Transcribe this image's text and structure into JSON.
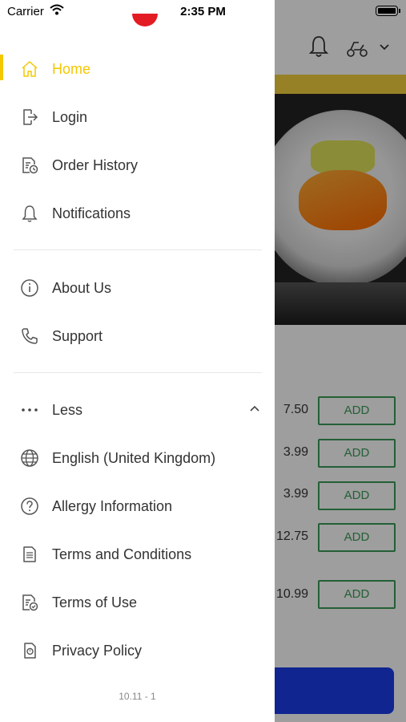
{
  "status_bar": {
    "carrier": "Carrier",
    "time": "2:35 PM"
  },
  "menu": {
    "primary": [
      {
        "label": "Home",
        "icon": "home-icon",
        "active": true
      },
      {
        "label": "Login",
        "icon": "login-icon"
      },
      {
        "label": "Order History",
        "icon": "order-history-icon"
      },
      {
        "label": "Notifications",
        "icon": "bell-icon"
      }
    ],
    "secondary": [
      {
        "label": "About Us",
        "icon": "info-icon"
      },
      {
        "label": "Support",
        "icon": "phone-icon"
      }
    ],
    "more": [
      {
        "label": "Less",
        "icon": "more-dots-icon"
      },
      {
        "label": "English (United Kingdom)",
        "icon": "globe-icon"
      },
      {
        "label": "Allergy Information",
        "icon": "question-icon"
      },
      {
        "label": "Terms and Conditions",
        "icon": "document-icon"
      },
      {
        "label": "Terms of Use",
        "icon": "document-check-icon"
      },
      {
        "label": "Privacy Policy",
        "icon": "privacy-icon"
      }
    ],
    "version": "10.11 - 1",
    "accent_color": "#f4c800"
  },
  "background": {
    "products": [
      {
        "price": "7.50",
        "add_label": "ADD"
      },
      {
        "price": "3.99",
        "add_label": "ADD"
      },
      {
        "price": "3.99",
        "add_label": "ADD"
      },
      {
        "price": "12.75",
        "add_label": "ADD"
      },
      {
        "price": "10.99",
        "add_label": "ADD"
      }
    ],
    "add_color": "#3b9a57",
    "cta_color": "#1a3ce8"
  }
}
